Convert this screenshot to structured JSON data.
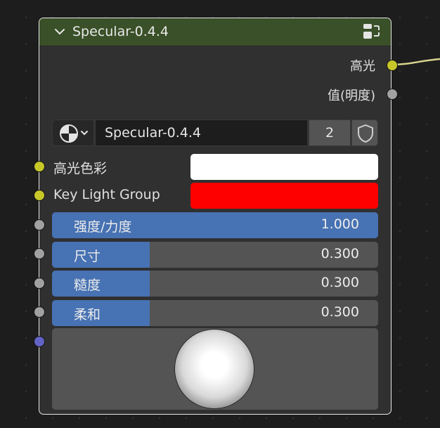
{
  "node": {
    "title": "Specular-0.4.4",
    "header_color": "#3a5028",
    "icons": {
      "collapse": "chevron-down-icon",
      "action": "node-tree-icon"
    }
  },
  "outputs": [
    {
      "label": "高光",
      "socket_color": "#c7c729",
      "connected": true
    },
    {
      "label": "值(明度)",
      "socket_color": "#a1a1a1",
      "connected": false
    }
  ],
  "group_bar": {
    "selector_icon": "node-tree-icon",
    "name": "Specular-0.4.4",
    "users": "2",
    "fake_user_icon": "shield-icon"
  },
  "color_inputs": [
    {
      "label": "高光色彩",
      "value": "#ffffff",
      "socket_color": "#c7c729"
    },
    {
      "label": "Key Light Group",
      "value": "#ff0000",
      "socket_color": "#c7c729"
    }
  ],
  "sliders": [
    {
      "label": "强度/力度",
      "value": "1.000",
      "fill_fraction": 1.0
    },
    {
      "label": "尺寸",
      "value": "0.300",
      "fill_fraction": 0.3
    },
    {
      "label": "糙度",
      "value": "0.300",
      "fill_fraction": 0.3
    },
    {
      "label": "柔和",
      "value": "0.300",
      "fill_fraction": 0.3
    }
  ],
  "preview": {
    "socket_color": "#6363c7",
    "shape": "sphere"
  },
  "colors": {
    "slider_accent": "#4772b3",
    "float_socket": "#a1a1a1",
    "color_socket": "#c7c729",
    "shader_socket": "#6363c7"
  }
}
